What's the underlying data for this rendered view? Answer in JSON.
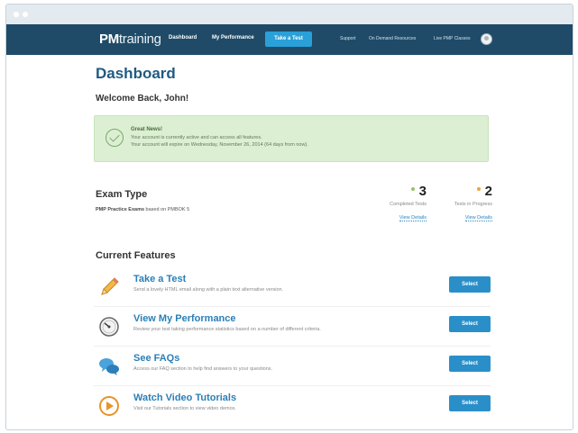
{
  "nav": {
    "logo_bold": "PM",
    "logo_rest": "training",
    "items": [
      "Dashboard",
      "My Performance"
    ],
    "active_item": "Take a Test",
    "right_links": [
      "Support",
      "On Demand Resources",
      "Live PMP Classes"
    ]
  },
  "page": {
    "title": "Dashboard",
    "welcome": "Welcome Back, John!"
  },
  "alert": {
    "title": "Great News!",
    "line1": "Your account is currently active and can access all features.",
    "line2": "Your account will expire on Wednesday, November 26, 2014 (64 days from now)."
  },
  "exam": {
    "title": "Exam Type",
    "sub_bold": "PMP Practice Exams",
    "sub_rest": " based on PMBOK 5",
    "stats": [
      {
        "value": "3",
        "label": "Completed Tests",
        "link": "View Details",
        "dot_color": "#9ac36b"
      },
      {
        "value": "2",
        "label": "Tests in Progress",
        "link": "View Details",
        "dot_color": "#f0a23a"
      }
    ]
  },
  "features": {
    "title": "Current Features",
    "items": [
      {
        "title": "Take a Test",
        "desc": "Send a lovely HTML email along with a plain text alternative version.",
        "button": "Select",
        "icon": "pencil-icon"
      },
      {
        "title": "View My Performance",
        "desc": "Review your test taking performance statistics based on a number of different criteria.",
        "button": "Select",
        "icon": "gauge-icon"
      },
      {
        "title": "See FAQs",
        "desc": "Access our FAQ section to help find answers to your questions.",
        "button": "Select",
        "icon": "chat-bubbles-icon"
      },
      {
        "title": "Watch Video Tutorials",
        "desc": "Visit our Tutorials section to view video demos.",
        "button": "Select",
        "icon": "play-icon"
      }
    ]
  }
}
